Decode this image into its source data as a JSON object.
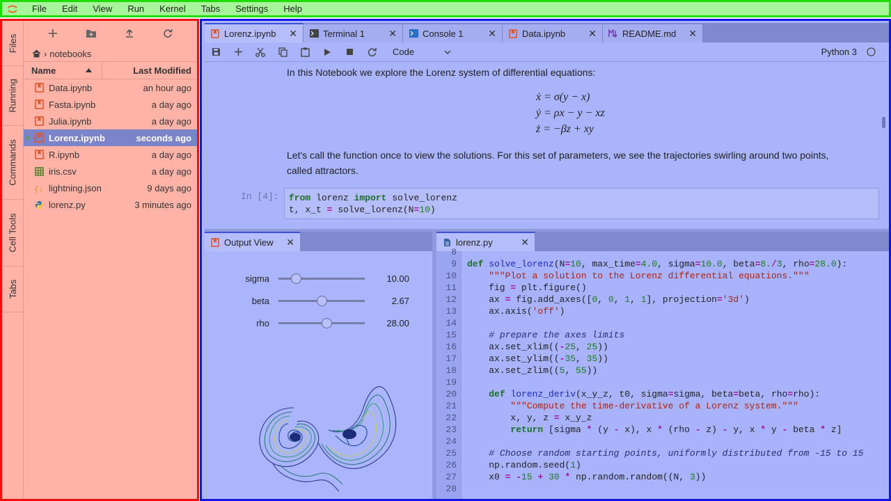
{
  "menubar": {
    "items": [
      "File",
      "Edit",
      "View",
      "Run",
      "Kernel",
      "Tabs",
      "Settings",
      "Help"
    ]
  },
  "sidebar": {
    "tabs": [
      "Files",
      "Running",
      "Commands",
      "Cell Tools",
      "Tabs"
    ]
  },
  "filebrowser": {
    "breadcrumb": "notebooks",
    "col_name": "Name",
    "col_modified": "Last Modified",
    "files": [
      {
        "name": "Data.ipynb",
        "modified": "an hour ago",
        "icon": "notebook-icon"
      },
      {
        "name": "Fasta.ipynb",
        "modified": "a day ago",
        "icon": "notebook-icon"
      },
      {
        "name": "Julia.ipynb",
        "modified": "a day ago",
        "icon": "notebook-icon"
      },
      {
        "name": "Lorenz.ipynb",
        "modified": "seconds ago",
        "icon": "notebook-icon"
      },
      {
        "name": "R.ipynb",
        "modified": "a day ago",
        "icon": "notebook-icon"
      },
      {
        "name": "iris.csv",
        "modified": "a day ago",
        "icon": "spreadsheet-icon"
      },
      {
        "name": "lightning.json",
        "modified": "9 days ago",
        "icon": "json-icon"
      },
      {
        "name": "lorenz.py",
        "modified": "3 minutes ago",
        "icon": "python-icon"
      }
    ]
  },
  "main": {
    "tabs": [
      {
        "label": "Lorenz.ipynb",
        "icon": "notebook-icon"
      },
      {
        "label": "Terminal 1",
        "icon": "terminal-icon"
      },
      {
        "label": "Console 1",
        "icon": "console-icon"
      },
      {
        "label": "Data.ipynb",
        "icon": "notebook-icon"
      },
      {
        "label": "README.md",
        "icon": "markdown-icon"
      }
    ],
    "cell_type": "Code",
    "kernel_name": "Python 3",
    "notebook": {
      "intro": "In this Notebook we explore the Lorenz system of differential equations:",
      "equations": [
        "ẋ = σ(y − x)",
        "ẏ = ρx − y − xz",
        "ż = −βz + xy"
      ],
      "para_line1": "Let's call the function once to view the solutions. For this set of parameters, we see the trajectories swirling around two points,",
      "para_line2": "called attractors.",
      "prompt": "In [4]:"
    }
  },
  "output_view": {
    "tab_label": "Output View",
    "sliders": [
      {
        "label": "sigma",
        "value": "10.00",
        "fraction": 0.2
      },
      {
        "label": "beta",
        "value": "2.67",
        "fraction": 0.5
      },
      {
        "label": "rho",
        "value": "28.00",
        "fraction": 0.56
      }
    ]
  },
  "editor": {
    "tab_label": "lorenz.py",
    "line_numbers": [
      "8",
      "9",
      "10",
      "11",
      "12",
      "13",
      "14",
      "15",
      "16",
      "17",
      "18",
      "19",
      "20",
      "21",
      "22",
      "23",
      "24",
      "25",
      "26",
      "27",
      "28"
    ]
  }
}
